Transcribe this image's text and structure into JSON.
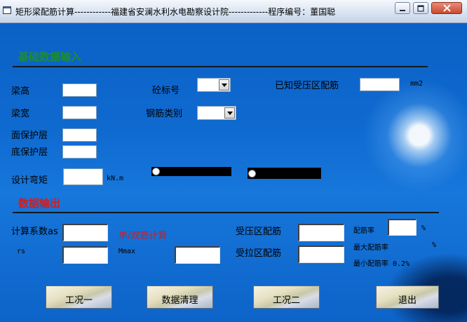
{
  "window": {
    "title": "矩形梁配筋计算------------福建省安澜水利水电勘察设计院-------------程序编号：董国聪",
    "buttons": {
      "minimize": "minimize",
      "maximize": "maximize",
      "close": "close"
    }
  },
  "input_section": {
    "title": "基础数据输入",
    "beam_height_label": "梁高",
    "beam_width_label": "梁宽",
    "top_cover_label": "面保护层",
    "bottom_cover_label": "底保护层",
    "design_moment_label": "设计弯矩",
    "moment_unit": "kN.m",
    "concrete_grade_label": "砼标号",
    "rebar_type_label": "钢筋类别",
    "known_compression_label": "已知受压区配筋",
    "area_unit": "mm2",
    "values": {
      "beam_height": "",
      "beam_width": "",
      "top_cover": "",
      "bottom_cover": "",
      "design_moment": "",
      "concrete_grade": "",
      "rebar_type": "",
      "known_compression": ""
    }
  },
  "output_section": {
    "title": "数据输出",
    "as_label": "计算系数as",
    "rs_label": "rs",
    "calc_mode_label": "单/双筋计算",
    "mmax_label": "Mmax",
    "compression_rebar_label": "受压区配筋",
    "tension_rebar_label": "受拉区配筋",
    "ratio_label": "配筋率",
    "ratio_unit": "%",
    "max_ratio_label": "最大配筋率",
    "max_ratio_unit": "%",
    "min_ratio_label": "最小配筋率 0.2%",
    "values": {
      "as": "",
      "rs": "",
      "mmax": "",
      "compression_rebar": "",
      "tension_rebar": "",
      "ratio": ""
    }
  },
  "actions": {
    "case1": "工况一",
    "clear": "数据清理",
    "case2": "工况二",
    "exit": "退出"
  },
  "colors": {
    "input_title": "#1e8e2a",
    "output_title": "#d31c1c",
    "calc_mode": "#d31c1c",
    "background": "#0f6ad0"
  }
}
